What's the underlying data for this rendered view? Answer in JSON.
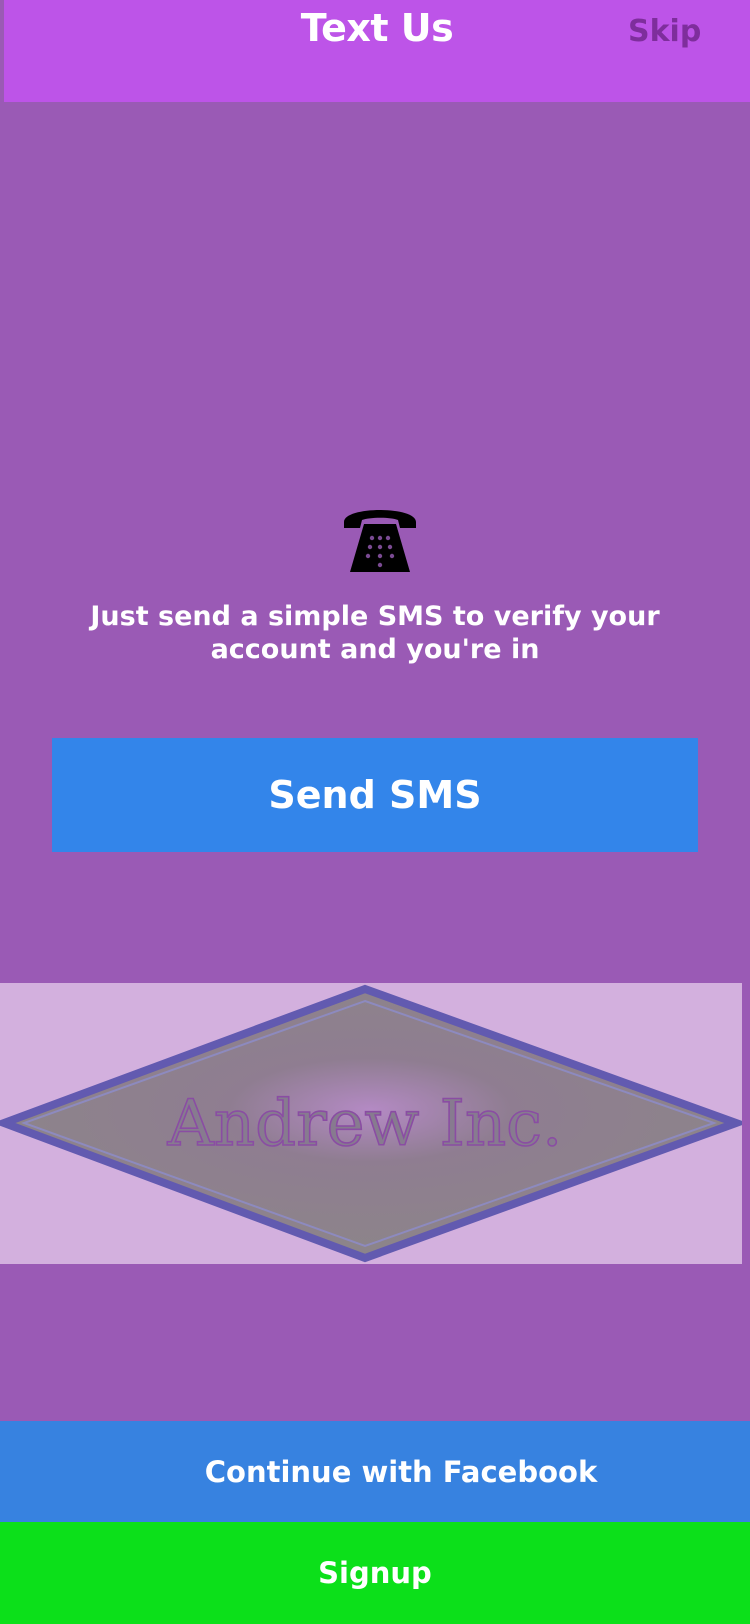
{
  "header": {
    "title": "Text Us",
    "skip_label": "Skip"
  },
  "main": {
    "icon": "telephone-icon",
    "message": "Just send a simple SMS to verify your account and you're in",
    "send_button_label": "Send SMS"
  },
  "logo": {
    "text": "Andrew Inc."
  },
  "footer": {
    "facebook_label": "Continue with Facebook",
    "signup_label": "Signup"
  },
  "colors": {
    "background": "#9a5ab5",
    "header": "#bd54e8",
    "skip_text": "#7e2e9c",
    "send_button": "#3385ea",
    "facebook_button": "#3782e0",
    "signup_button": "#0ce01a",
    "logo_panel": "#d3b0de"
  }
}
